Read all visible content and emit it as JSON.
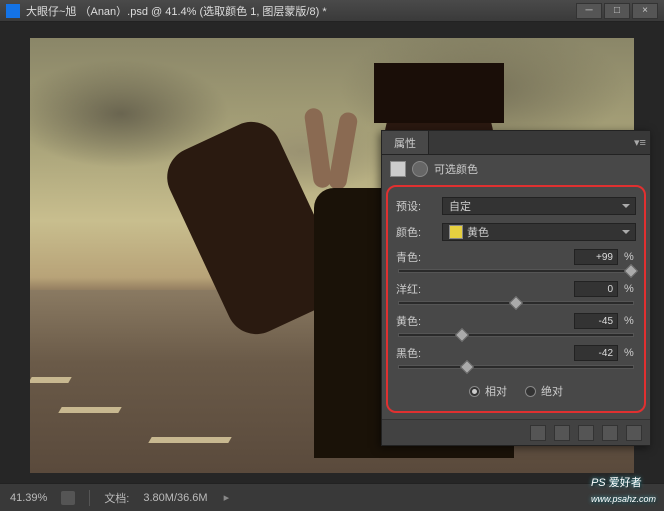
{
  "titlebar": {
    "title": "大眼仔~旭 （Anan）.psd @ 41.4% (选取颜色 1, 图层蒙版/8) *"
  },
  "statusbar": {
    "zoom": "41.39%",
    "doc_label": "文档:",
    "doc_size": "3.80M/36.6M"
  },
  "panel": {
    "tab": "属性",
    "adjustment_name": "可选颜色",
    "preset_label": "预设:",
    "preset_value": "自定",
    "color_label": "颜色:",
    "color_value": "黄色",
    "sliders": {
      "cyan": {
        "label": "青色:",
        "value": "+99",
        "percent": 99
      },
      "magenta": {
        "label": "洋红:",
        "value": "0",
        "percent": 50
      },
      "yellow": {
        "label": "黄色:",
        "value": "-45",
        "percent": 27
      },
      "black": {
        "label": "黑色:",
        "value": "-42",
        "percent": 29
      }
    },
    "unit": "%",
    "radio_relative": "相对",
    "radio_absolute": "绝对",
    "radio_selected": "relative"
  },
  "watermark": {
    "en": "PS",
    "cn": " 爱好者",
    "url": "www.psahz.com"
  }
}
